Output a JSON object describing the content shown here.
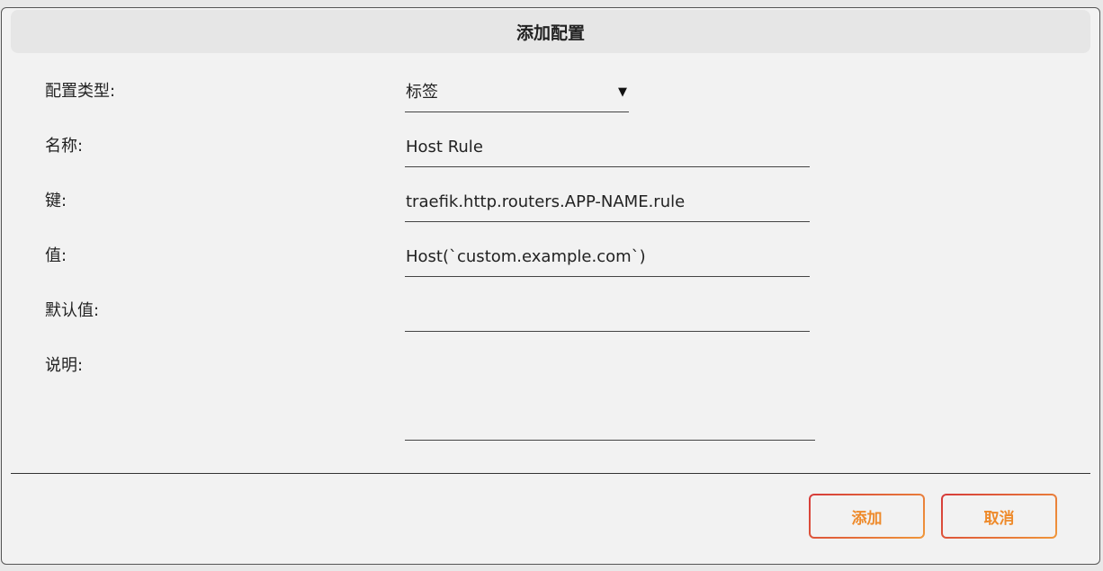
{
  "dialog": {
    "title": "添加配置"
  },
  "form": {
    "type_label": "配置类型:",
    "type_value": "标签",
    "name_label": "名称:",
    "name_value": "Host Rule",
    "key_label": "键:",
    "key_value": "traefik.http.routers.APP-NAME.rule",
    "value_label": "值:",
    "value_value": "Host(`custom.example.com`)",
    "default_label": "默认值:",
    "default_value": "",
    "desc_label": "说明:",
    "desc_value": ""
  },
  "buttons": {
    "add_label": "添加",
    "cancel_label": "取消"
  },
  "icons": {
    "select_arrow": "dropdown-arrow"
  },
  "colors": {
    "button_text": "#ee8a2b",
    "button_border_start": "#d63a3a",
    "button_border_end": "#f0973a"
  }
}
